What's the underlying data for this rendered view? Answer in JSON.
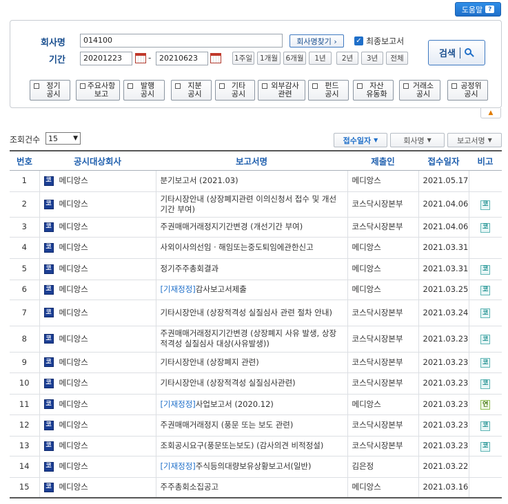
{
  "help": {
    "label": "도움말",
    "icon": "question-icon"
  },
  "search": {
    "company_label": "회사명",
    "company_value": "014100",
    "find_company_label": "회사명찾기 ›",
    "final_report_label": "최종보고서",
    "final_report_checked": true,
    "period_label": "기간",
    "start_date": "20201223",
    "end_date": "20210623",
    "range_sep": "-",
    "period_buttons": [
      "1주일",
      "1개월",
      "6개월",
      "1년",
      "2년",
      "3년",
      "전체"
    ],
    "search_label": "검색",
    "types": [
      [
        "정기",
        "공시"
      ],
      [
        "주요사항",
        "보고"
      ],
      [
        "발행",
        "공시"
      ],
      [
        "지분",
        "공시"
      ],
      [
        "기타",
        "공시"
      ],
      [
        "외부감사",
        "관련"
      ],
      [
        "펀드",
        "공시"
      ],
      [
        "자산",
        "유동화"
      ],
      [
        "거래소",
        "공시"
      ],
      [
        "공정위",
        "공시"
      ]
    ]
  },
  "collapse_icon": "chevron-up-icon",
  "list_controls": {
    "count_label": "조회건수",
    "count_value": "15",
    "sort": [
      "접수일자",
      "회사명",
      "보고서명"
    ]
  },
  "table": {
    "headers": [
      "번호",
      "공시대상회사",
      "보고서명",
      "제출인",
      "접수일자",
      "비고"
    ],
    "rows": [
      {
        "no": "1",
        "mark": "코",
        "company": "메디앙스",
        "prefix": "",
        "report": "분기보고서 (2021.03)",
        "submitter": "메디앙스",
        "date": "2021.05.17",
        "note": ""
      },
      {
        "no": "2",
        "mark": "코",
        "company": "메디앙스",
        "prefix": "",
        "report": "기타시장안내 (상장폐지관련 이의신청서 접수 및 개선기간 부여)",
        "submitter": "코스닥시장본부",
        "date": "2021.04.06",
        "note": "코"
      },
      {
        "no": "3",
        "mark": "코",
        "company": "메디앙스",
        "prefix": "",
        "report": "주권매매거래정지기간변경 (개선기간 부여)",
        "submitter": "코스닥시장본부",
        "date": "2021.04.06",
        "note": "코"
      },
      {
        "no": "4",
        "mark": "코",
        "company": "메디앙스",
        "prefix": "",
        "report": "사외이사의선임ㆍ해임또는중도퇴임에관한신고",
        "submitter": "메디앙스",
        "date": "2021.03.31",
        "note": ""
      },
      {
        "no": "5",
        "mark": "코",
        "company": "메디앙스",
        "prefix": "",
        "report": "정기주주총회결과",
        "submitter": "메디앙스",
        "date": "2021.03.31",
        "note": "코"
      },
      {
        "no": "6",
        "mark": "코",
        "company": "메디앙스",
        "prefix": "[기재정정]",
        "report": "감사보고서제출",
        "submitter": "메디앙스",
        "date": "2021.03.25",
        "note": "코"
      },
      {
        "no": "7",
        "mark": "코",
        "company": "메디앙스",
        "prefix": "",
        "report": "기타시장안내 (상장적격성 실질심사 관련 절차 안내)",
        "submitter": "코스닥시장본부",
        "date": "2021.03.24",
        "note": "코"
      },
      {
        "no": "8",
        "mark": "코",
        "company": "메디앙스",
        "prefix": "",
        "report": "주권매매거래정지기간변경 (상장폐지 사유 발생, 상장적격성 실질심사 대상(사유발생))",
        "submitter": "코스닥시장본부",
        "date": "2021.03.23",
        "note": "코"
      },
      {
        "no": "9",
        "mark": "코",
        "company": "메디앙스",
        "prefix": "",
        "report": "기타시장안내 (상장폐지 관련)",
        "submitter": "코스닥시장본부",
        "date": "2021.03.23",
        "note": "코"
      },
      {
        "no": "10",
        "mark": "코",
        "company": "메디앙스",
        "prefix": "",
        "report": "기타시장안내 (상장적격성 실질심사관련)",
        "submitter": "코스닥시장본부",
        "date": "2021.03.23",
        "note": "코"
      },
      {
        "no": "11",
        "mark": "코",
        "company": "메디앙스",
        "prefix": "[기재정정]",
        "report": "사업보고서 (2020.12)",
        "submitter": "메디앙스",
        "date": "2021.03.23",
        "note": "연"
      },
      {
        "no": "12",
        "mark": "코",
        "company": "메디앙스",
        "prefix": "",
        "report": "주권매매거래정지 (풍문 또는 보도 관련)",
        "submitter": "코스닥시장본부",
        "date": "2021.03.23",
        "note": "코"
      },
      {
        "no": "13",
        "mark": "코",
        "company": "메디앙스",
        "prefix": "",
        "report": "조회공시요구(풍문또는보도) (감사의견 비적정설)",
        "submitter": "코스닥시장본부",
        "date": "2021.03.23",
        "note": "코"
      },
      {
        "no": "14",
        "mark": "코",
        "company": "메디앙스",
        "prefix": "[기재정정]",
        "report": "주식등의대량보유상황보고서(일반)",
        "submitter": "김은정",
        "date": "2021.03.22",
        "note": ""
      },
      {
        "no": "15",
        "mark": "코",
        "company": "메디앙스",
        "prefix": "",
        "report": "주주총회소집공고",
        "submitter": "메디앙스",
        "date": "2021.03.16",
        "note": ""
      }
    ]
  }
}
